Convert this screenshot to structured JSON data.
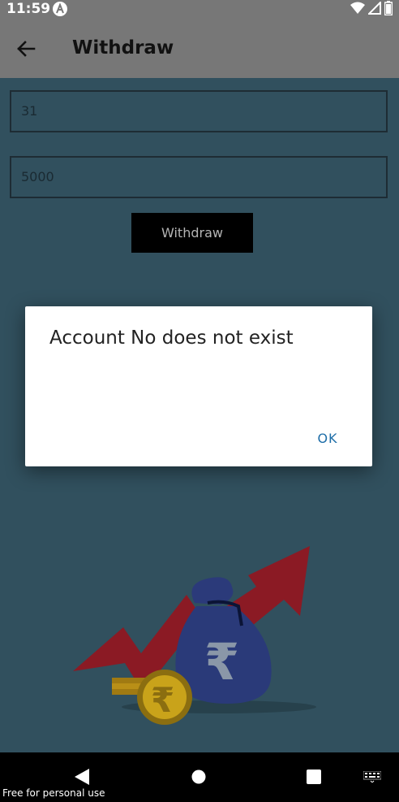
{
  "status_bar": {
    "time": "11:59"
  },
  "app_bar": {
    "title": "Withdraw"
  },
  "form": {
    "account_value": "31",
    "amount_value": "5000",
    "withdraw_label": "Withdraw"
  },
  "dialog": {
    "message": "Account No does not exist",
    "ok_label": "OK"
  },
  "watermark": "Free for personal use",
  "colors": {
    "app_bar": "#777777",
    "background": "#31505e",
    "dialog_button": "#1e6ea8"
  }
}
